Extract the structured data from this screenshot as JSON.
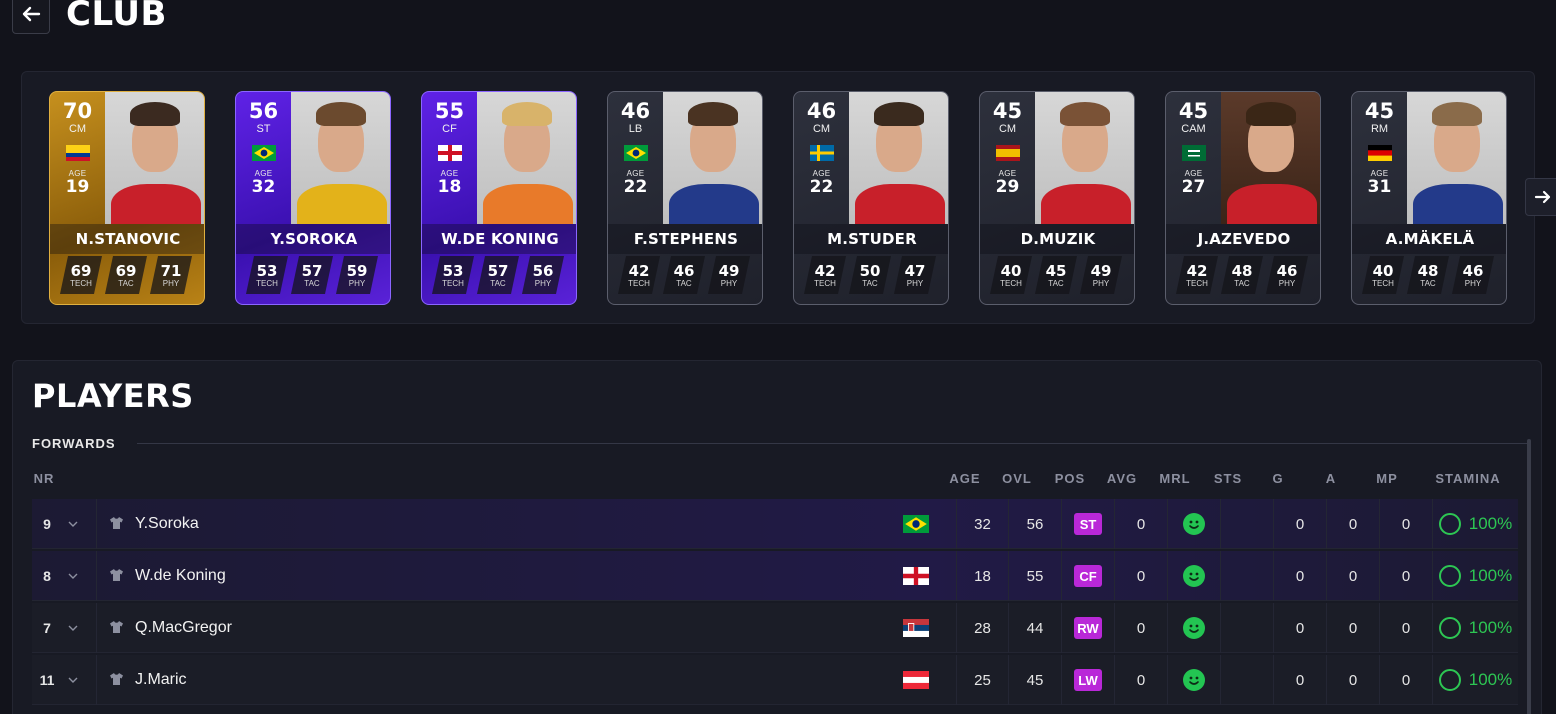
{
  "header": {
    "title": "CLUB"
  },
  "cards": [
    {
      "ovr": "70",
      "pos": "CM",
      "flag": "colombia",
      "age_label": "AGE",
      "age": "19",
      "name": "N.STANOVIC",
      "tier": "gold",
      "stats": [
        {
          "v": "69",
          "l": "TECH"
        },
        {
          "v": "69",
          "l": "TAC"
        },
        {
          "v": "71",
          "l": "PHY"
        }
      ],
      "hair": "#3b2a20",
      "shirt": "#c8202a"
    },
    {
      "ovr": "56",
      "pos": "ST",
      "flag": "brazil",
      "age_label": "AGE",
      "age": "32",
      "name": "Y.SOROKA",
      "tier": "purple",
      "stats": [
        {
          "v": "53",
          "l": "TECH"
        },
        {
          "v": "57",
          "l": "TAC"
        },
        {
          "v": "59",
          "l": "PHY"
        }
      ],
      "hair": "#6b4a2e",
      "shirt": "#e3b21a"
    },
    {
      "ovr": "55",
      "pos": "CF",
      "flag": "england",
      "age_label": "AGE",
      "age": "18",
      "name": "W.DE KONING",
      "tier": "purple",
      "stats": [
        {
          "v": "53",
          "l": "TECH"
        },
        {
          "v": "57",
          "l": "TAC"
        },
        {
          "v": "56",
          "l": "PHY"
        }
      ],
      "hair": "#d8b36a",
      "shirt": "#e87a2a"
    },
    {
      "ovr": "46",
      "pos": "LB",
      "flag": "brazil",
      "age_label": "AGE",
      "age": "22",
      "name": "F.STEPHENS",
      "tier": "silver",
      "stats": [
        {
          "v": "42",
          "l": "TECH"
        },
        {
          "v": "46",
          "l": "TAC"
        },
        {
          "v": "49",
          "l": "PHY"
        }
      ],
      "hair": "#4a3322",
      "shirt": "#233a8a"
    },
    {
      "ovr": "46",
      "pos": "CM",
      "flag": "sweden",
      "age_label": "AGE",
      "age": "22",
      "name": "M.STUDER",
      "tier": "silver",
      "stats": [
        {
          "v": "42",
          "l": "TECH"
        },
        {
          "v": "50",
          "l": "TAC"
        },
        {
          "v": "47",
          "l": "PHY"
        }
      ],
      "hair": "#3a2a1e",
      "shirt": "#c8202a"
    },
    {
      "ovr": "45",
      "pos": "CM",
      "flag": "spain",
      "age_label": "AGE",
      "age": "29",
      "name": "D.MUZIK",
      "tier": "silver",
      "stats": [
        {
          "v": "40",
          "l": "TECH"
        },
        {
          "v": "45",
          "l": "TAC"
        },
        {
          "v": "49",
          "l": "PHY"
        }
      ],
      "hair": "#7a5236",
      "shirt": "#c8202a"
    },
    {
      "ovr": "45",
      "pos": "CAM",
      "flag": "saudi",
      "age_label": "AGE",
      "age": "27",
      "name": "J.AZEVEDO",
      "tier": "silver",
      "stats": [
        {
          "v": "42",
          "l": "TECH"
        },
        {
          "v": "48",
          "l": "TAC"
        },
        {
          "v": "46",
          "l": "PHY"
        }
      ],
      "hair": "#3a2616",
      "shirt": "#c8202a"
    },
    {
      "ovr": "45",
      "pos": "RM",
      "flag": "germany",
      "age_label": "AGE",
      "age": "31",
      "name": "A.MÄKELÄ",
      "tier": "silver",
      "stats": [
        {
          "v": "40",
          "l": "TECH"
        },
        {
          "v": "48",
          "l": "TAC"
        },
        {
          "v": "46",
          "l": "PHY"
        }
      ],
      "hair": "#8a6b4a",
      "shirt": "#233a8a"
    }
  ],
  "players": {
    "title": "PLAYERS",
    "section": "FORWARDS",
    "columns": [
      "NR",
      "AGE",
      "OVL",
      "POS",
      "AVG",
      "MRL",
      "STS",
      "G",
      "A",
      "MP",
      "STAMINA"
    ],
    "rows": [
      {
        "nr": "9",
        "name": "Y.Soroka",
        "flag": "brazil",
        "age": "32",
        "ovl": "56",
        "pos": "ST",
        "avg": "0",
        "mrl": "happy",
        "sts": "",
        "g": "0",
        "a": "0",
        "mp": "0",
        "stamina": "100%",
        "selected": true
      },
      {
        "nr": "8",
        "name": "W.de Koning",
        "flag": "england",
        "age": "18",
        "ovl": "55",
        "pos": "CF",
        "avg": "0",
        "mrl": "happy",
        "sts": "",
        "g": "0",
        "a": "0",
        "mp": "0",
        "stamina": "100%",
        "selected": true
      },
      {
        "nr": "7",
        "name": "Q.MacGregor",
        "flag": "serbia",
        "age": "28",
        "ovl": "44",
        "pos": "RW",
        "avg": "0",
        "mrl": "happy",
        "sts": "",
        "g": "0",
        "a": "0",
        "mp": "0",
        "stamina": "100%",
        "selected": false
      },
      {
        "nr": "11",
        "name": "J.Maric",
        "flag": "austria",
        "age": "25",
        "ovl": "45",
        "pos": "LW",
        "avg": "0",
        "mrl": "happy",
        "sts": "",
        "g": "0",
        "a": "0",
        "mp": "0",
        "stamina": "100%",
        "selected": false
      }
    ]
  },
  "colors": {
    "accent_purple": "#5f22e6",
    "gold": "#c6901e",
    "badge": "#b928d8",
    "green": "#2dc653"
  }
}
